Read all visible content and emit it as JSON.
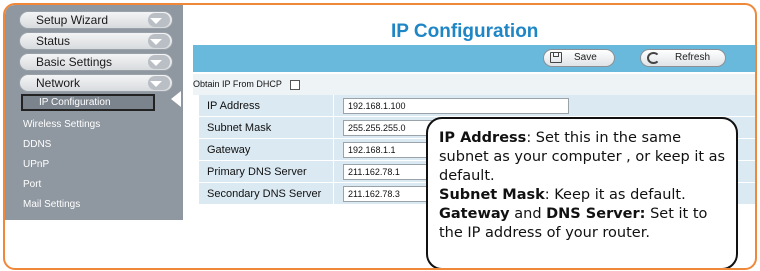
{
  "sidebar": {
    "sections": [
      {
        "label": "Setup Wizard"
      },
      {
        "label": "Status"
      },
      {
        "label": "Basic Settings"
      },
      {
        "label": "Network"
      }
    ],
    "network_items": [
      {
        "label": "IP Configuration",
        "active": true
      },
      {
        "label": "Wireless Settings"
      },
      {
        "label": "DDNS"
      },
      {
        "label": "UPnP"
      },
      {
        "label": "Port"
      },
      {
        "label": "Mail Settings"
      }
    ]
  },
  "main": {
    "title": "IP Configuration",
    "toolbar": {
      "save_label": "Save",
      "refresh_label": "Refresh"
    },
    "dhcp_label": "Obtain IP From DHCP",
    "dhcp_checked": false,
    "fields": [
      {
        "label": "IP Address",
        "value": "192.168.1.100"
      },
      {
        "label": "Subnet Mask",
        "value": "255.255.255.0"
      },
      {
        "label": "Gateway",
        "value": "192.168.1.1"
      },
      {
        "label": "Primary DNS Server",
        "value": "211.162.78.1"
      },
      {
        "label": "Secondary DNS Server",
        "value": "211.162.78.3"
      }
    ]
  },
  "callout": {
    "ip_title": "IP Address",
    "ip_text": ": Set this in the same subnet as your computer , or keep it as default.",
    "mask_title": "Subnet Mask",
    "mask_text": ": Keep it as default.",
    "gw_title": "Gateway",
    "and_text": " and ",
    "dns_title": "DNS Server:",
    "gw_text": " Set it to the IP address of your router."
  },
  "colors": {
    "frame": "#f0883a",
    "title": "#1f86c6",
    "toolbar": "#69b9dc",
    "sidebar": "#8f97a0"
  }
}
